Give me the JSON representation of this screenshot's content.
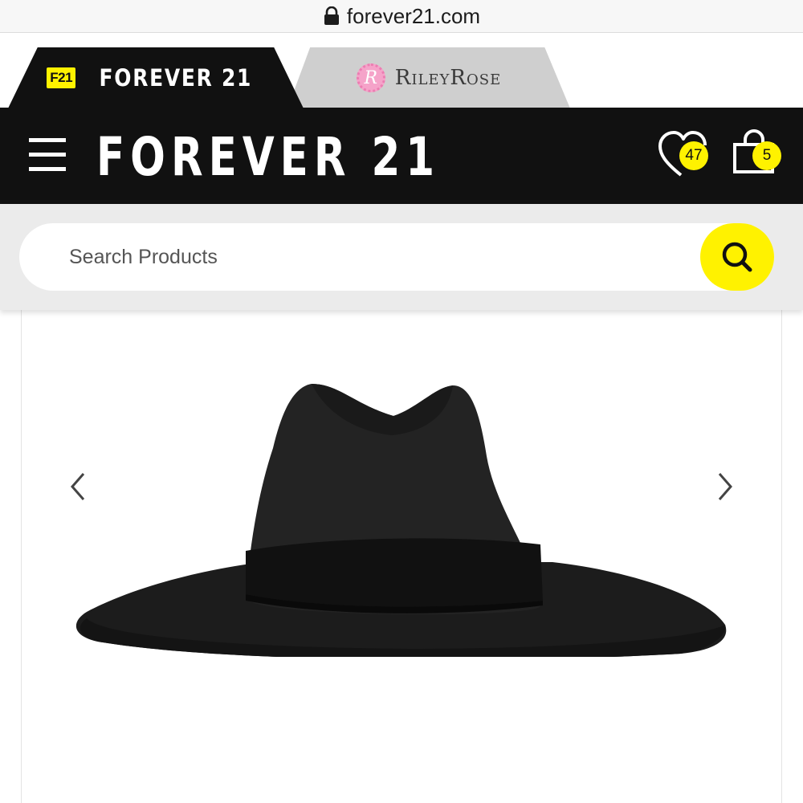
{
  "browser": {
    "url": "forever21.com"
  },
  "brand_tabs": [
    {
      "badge": "F21",
      "label": "FOREVER 21",
      "active": true
    },
    {
      "icon_letter": "R",
      "label": "RileyRose",
      "active": false
    }
  ],
  "header": {
    "logo": "FOREVER 21",
    "wishlist_count": "47",
    "cart_count": "5"
  },
  "search": {
    "placeholder": "Search Products"
  },
  "colors": {
    "brand_black": "#111111",
    "accent_yellow": "#fff200",
    "rr_pink": "#f5a3c9"
  },
  "icons": [
    "lock-icon",
    "menu-icon",
    "heart-icon",
    "shopping-bag-icon",
    "search-icon",
    "chevron-left-icon",
    "chevron-right-icon"
  ]
}
